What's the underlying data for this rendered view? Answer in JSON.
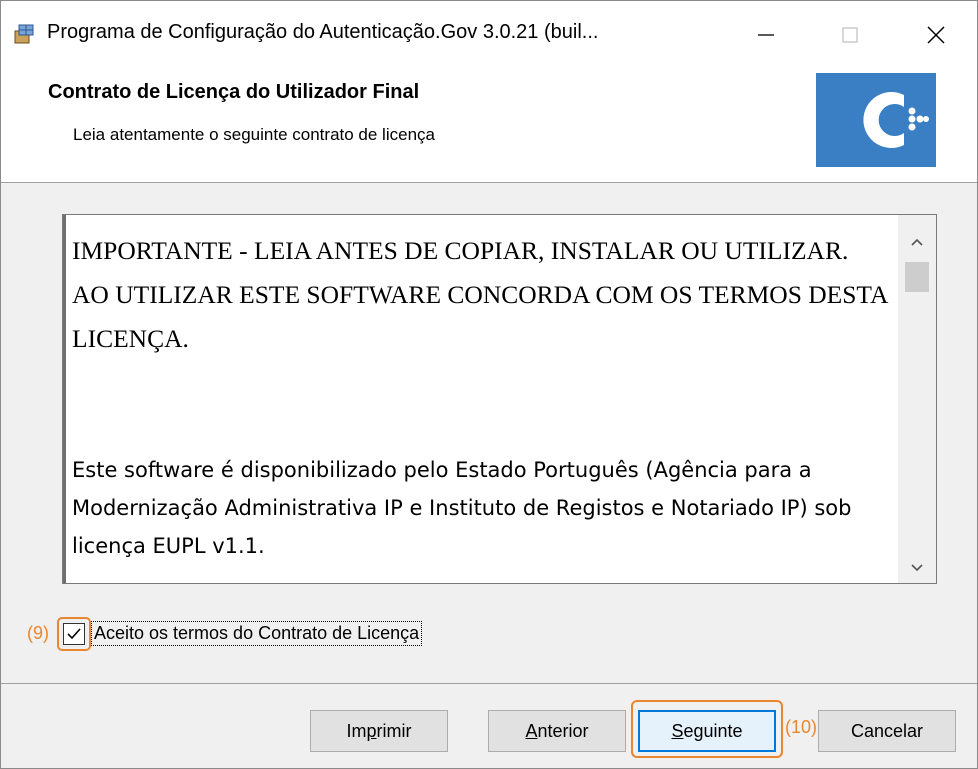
{
  "window": {
    "title": "Programa de Configuração do Autenticação.Gov 3.0.21 (buil...",
    "minimize_icon": "minimize-icon",
    "maximize_icon": "maximize-icon",
    "close_icon": "close-icon"
  },
  "banner": {
    "title": "Contrato de Licença do Utilizador Final",
    "subtitle": "Leia atentamente o seguinte contrato de licença",
    "logo_color": "#3a7fc4"
  },
  "license": {
    "heading": "IMPORTANTE - LEIA ANTES DE COPIAR, INSTALAR OU UTILIZAR. AO UTILIZAR ESTE SOFTWARE CONCORDA COM OS TERMOS DESTA LICENÇA.",
    "paragraph": "Este software é disponibilizado pelo Estado Português (Agência para a Modernização Administrativa IP e Instituto de Registos e Notariado IP) sob licença EUPL v1.1."
  },
  "accept": {
    "label": "Aceito os termos do Contrato de Licença",
    "checked": true,
    "annotation": "(9)"
  },
  "buttons": {
    "print": {
      "label_pre": "Im",
      "label_u": "p",
      "label_post": "rimir"
    },
    "back": {
      "label_pre": "",
      "label_u": "A",
      "label_post": "nterior"
    },
    "next": {
      "label_pre": "",
      "label_u": "S",
      "label_post": "eguinte",
      "annotation": "(10)"
    },
    "cancel": {
      "label": "Cancelar"
    }
  },
  "colors": {
    "accent": "#0078d7",
    "annotation": "#e8872f"
  }
}
